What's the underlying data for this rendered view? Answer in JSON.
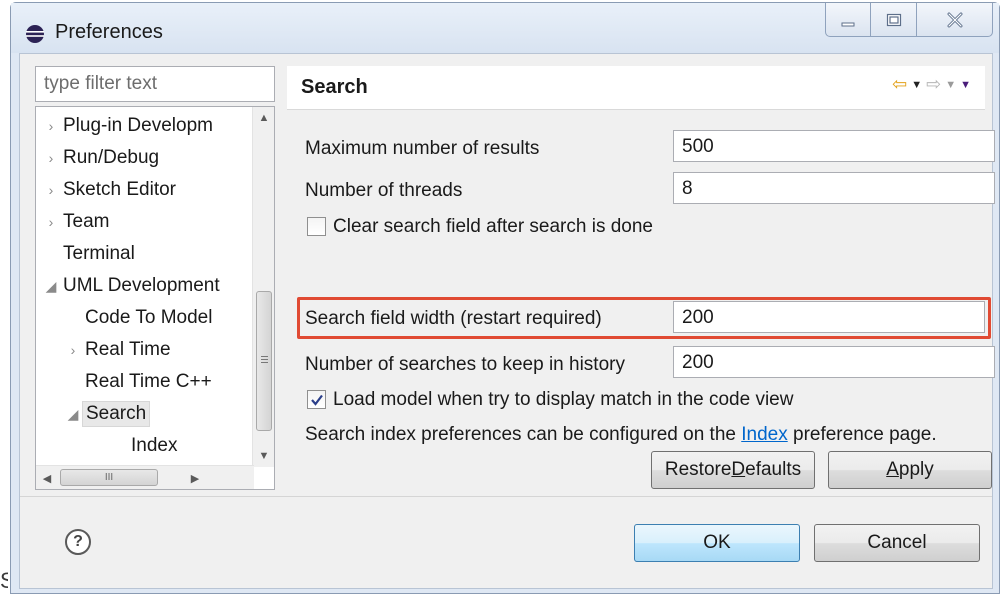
{
  "window": {
    "title": "Preferences",
    "controls": {
      "minimize": "minimize",
      "maximize": "maximize",
      "close": "close"
    }
  },
  "filter": {
    "placeholder": "type filter text"
  },
  "tree": {
    "items": [
      {
        "label": "Plug-in Developm",
        "arrow": "›",
        "indent": 0
      },
      {
        "label": "Run/Debug",
        "arrow": "›",
        "indent": 0
      },
      {
        "label": "Sketch Editor",
        "arrow": "›",
        "indent": 0
      },
      {
        "label": "Team",
        "arrow": "›",
        "indent": 0
      },
      {
        "label": "Terminal",
        "arrow": "",
        "indent": 0
      },
      {
        "label": "UML Development",
        "arrow": "◢",
        "indent": 0
      },
      {
        "label": "Code To Model",
        "arrow": "",
        "indent": 1
      },
      {
        "label": "Real Time",
        "arrow": "›",
        "indent": 1
      },
      {
        "label": "Real Time C++",
        "arrow": "",
        "indent": 1
      },
      {
        "label": "Search",
        "arrow": "◢",
        "indent": 1,
        "selected": true
      },
      {
        "label": "Index",
        "arrow": "",
        "indent": 2
      }
    ],
    "hscroll_thumb": "III"
  },
  "page": {
    "title": "Search",
    "fields": {
      "max_results": {
        "label": "Maximum number of results",
        "value": "500"
      },
      "threads": {
        "label": "Number of threads",
        "value": "8"
      },
      "clear_after_search": {
        "label": "Clear search field after search is done",
        "checked": false
      },
      "field_width": {
        "label": "Search field width (restart required)",
        "value": "200"
      },
      "history": {
        "label": "Number of searches to keep in history",
        "value": "200"
      },
      "load_model": {
        "label": "Load model when try to display match in the code view",
        "checked": true
      }
    },
    "info": {
      "before": "Search index preferences can be configured on the ",
      "link": "Index",
      "after": " preference page."
    },
    "restore_defaults_label": "Restore Defaults",
    "apply_label": "Apply"
  },
  "footer": {
    "help": "?",
    "ok_label": "OK",
    "cancel_label": "Cancel"
  },
  "outside": {
    "letter": "S"
  },
  "colors": {
    "highlight": "#e04a33",
    "link": "#0066cc",
    "nav_back": "#e3a21a"
  }
}
